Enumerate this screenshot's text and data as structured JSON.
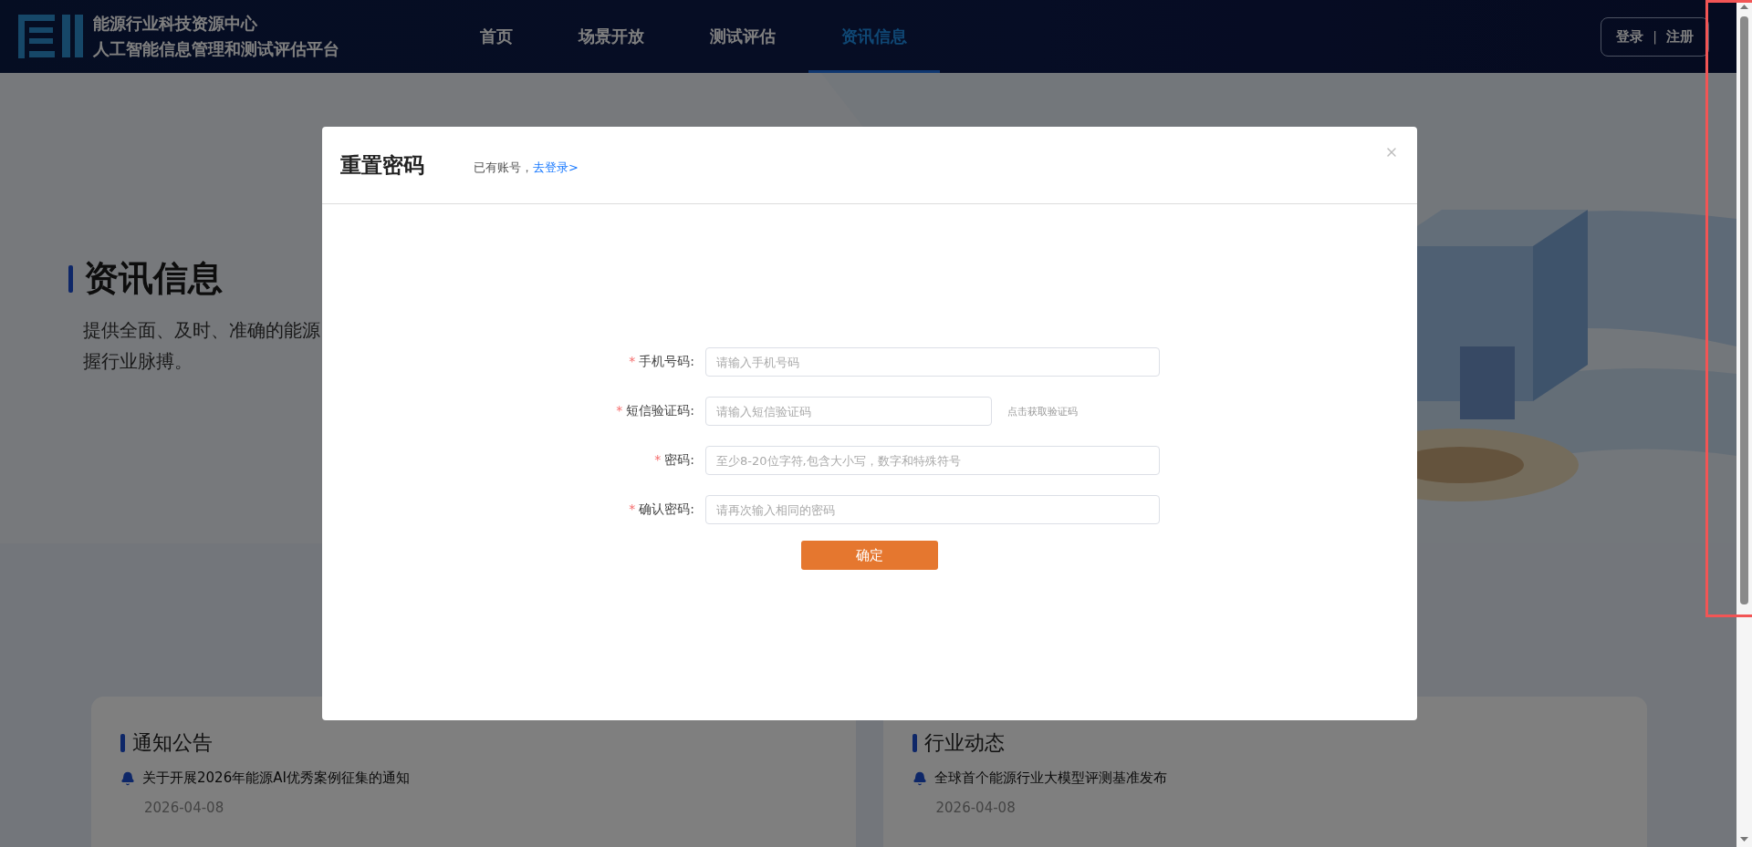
{
  "header": {
    "logo_lines": [
      "能源行业科技资源中心",
      "人工智能信息管理和测试评估平台"
    ],
    "nav": [
      {
        "label": "首页",
        "selected": false
      },
      {
        "label": "场景开放",
        "selected": false
      },
      {
        "label": "测试评估",
        "selected": false
      },
      {
        "label": "资讯信息",
        "selected": true
      }
    ],
    "auth": {
      "login": "登录",
      "separator": "|",
      "register": "注册"
    }
  },
  "hero": {
    "title": "资讯信息",
    "description_lines": [
      "提供全面、及时、准确的能源",
      "握行业脉搏。"
    ]
  },
  "cards": [
    {
      "title": "通知公告",
      "items": [
        {
          "title": "关于开展2026年能源AI优秀案例征集的通知",
          "date": "2026-04-08"
        }
      ]
    },
    {
      "title": "行业动态",
      "items": [
        {
          "title": "全球首个能源行业大模型评测基准发布",
          "date": "2026-04-08"
        }
      ]
    }
  ],
  "modal": {
    "title": "重置密码",
    "account_prompt": "已有账号，",
    "login_link": "去登录>",
    "required_mark": "*",
    "fields": [
      {
        "kind": "text",
        "label": "手机号码:",
        "required": true,
        "placeholder": "请输入手机号码"
      },
      {
        "kind": "code",
        "label": "短信验证码:",
        "required": true,
        "placeholder": "请输入短信验证码",
        "action": "点击获取验证码"
      },
      {
        "kind": "text",
        "label": "密码:",
        "required": true,
        "placeholder": "至少8-20位字符,包含大小写，数字和特殊符号"
      },
      {
        "kind": "text",
        "label": "确认密码:",
        "required": true,
        "placeholder": "请再次输入相同的密码"
      }
    ],
    "submit": "确定"
  }
}
